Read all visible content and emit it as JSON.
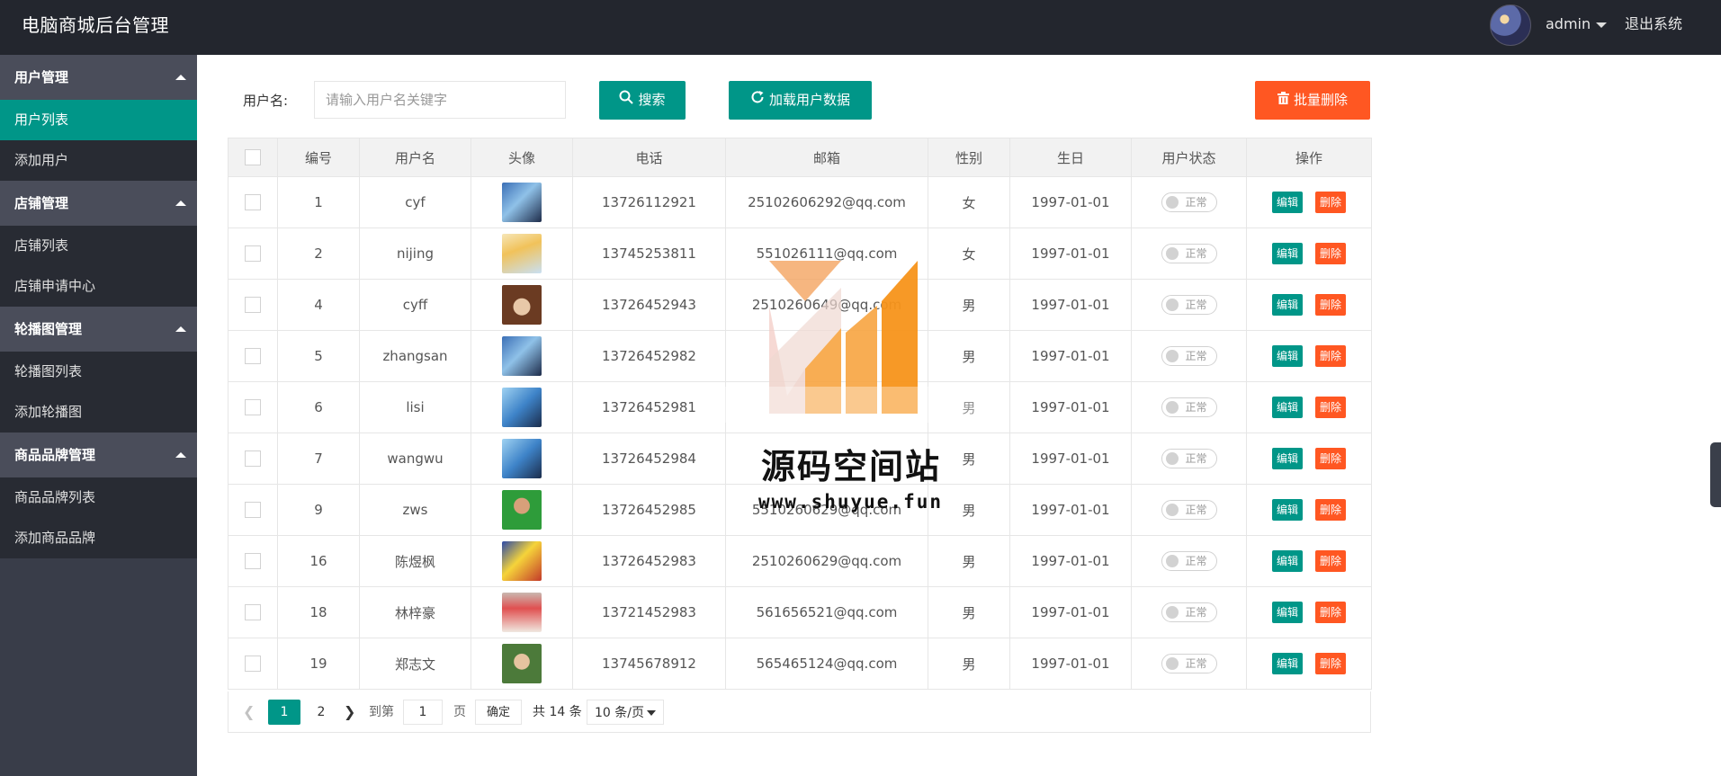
{
  "header": {
    "title": "电脑商城后台管理",
    "username": "admin",
    "logout_label": "退出系统"
  },
  "sidebar": {
    "groups": [
      {
        "title": "用户管理",
        "items": [
          {
            "label": "用户列表",
            "active": true
          },
          {
            "label": "添加用户"
          }
        ]
      },
      {
        "title": "店铺管理",
        "items": [
          {
            "label": "店铺列表"
          },
          {
            "label": "店铺申请中心"
          }
        ]
      },
      {
        "title": "轮播图管理",
        "items": [
          {
            "label": "轮播图列表"
          },
          {
            "label": "添加轮播图"
          }
        ]
      },
      {
        "title": "商品品牌管理",
        "items": [
          {
            "label": "商品品牌列表"
          },
          {
            "label": "添加商品品牌"
          }
        ]
      }
    ]
  },
  "toolbar": {
    "username_label": "用户名:",
    "search_placeholder": "请输入用户名关键字",
    "search_value": "",
    "search_button": "搜索",
    "load_button": "加载用户数据",
    "batch_delete_button": "批量删除"
  },
  "table": {
    "columns": [
      "编号",
      "用户名",
      "头像",
      "电话",
      "邮箱",
      "性别",
      "生日",
      "用户状态",
      "操作"
    ],
    "rows": [
      {
        "id": "1",
        "username": "cyf",
        "avatar": "avatar-photo",
        "phone": "13726112921",
        "email": "2510260629​2@qq.com",
        "gender": "女",
        "birthday": "1997-01-01",
        "status": "正常"
      },
      {
        "id": "2",
        "username": "nijing",
        "avatar": "avatar-photo",
        "phone": "13745253811",
        "email": "551026111@qq.com",
        "gender": "女",
        "birthday": "1997-01-01",
        "status": "正常"
      },
      {
        "id": "4",
        "username": "cyff",
        "avatar": "avatar-photo",
        "phone": "13726452943",
        "email": "2510260649@qq.com",
        "gender": "男",
        "birthday": "1997-01-01",
        "status": "正常"
      },
      {
        "id": "5",
        "username": "zhangsan",
        "avatar": "avatar-photo",
        "phone": "13726452982",
        "email": "",
        "gender": "男",
        "birthday": "1997-01-01",
        "status": "正常"
      },
      {
        "id": "6",
        "username": "lisi",
        "avatar": "avatar-photo",
        "phone": "13726452981",
        "email": "",
        "gender": "男",
        "birthday": "1997-01-01",
        "status": "正常"
      },
      {
        "id": "7",
        "username": "wangwu",
        "avatar": "avatar-photo",
        "phone": "13726452984",
        "email": "",
        "gender": "男",
        "birthday": "1997-01-01",
        "status": "正常"
      },
      {
        "id": "9",
        "username": "zws",
        "avatar": "avatar-photo",
        "phone": "13726452985",
        "email": "5510260629@qq.com",
        "gender": "男",
        "birthday": "1997-01-01",
        "status": "正常"
      },
      {
        "id": "16",
        "username": "陈煜枫",
        "avatar": "avatar-photo",
        "phone": "13726452983",
        "email": "2510260629@qq.com",
        "gender": "男",
        "birthday": "1997-01-01",
        "status": "正常"
      },
      {
        "id": "18",
        "username": "林梓豪",
        "avatar": "avatar-photo",
        "phone": "13721452983",
        "email": "561656521@qq.com",
        "gender": "男",
        "birthday": "1997-01-01",
        "status": "正常"
      },
      {
        "id": "19",
        "username": "郑志文",
        "avatar": "avatar-photo",
        "phone": "13745678912",
        "email": "565465124@qq.com",
        "gender": "男",
        "birthday": "1997-01-01",
        "status": "正常"
      }
    ],
    "edit_label": "编辑",
    "delete_label": "删除"
  },
  "pager": {
    "current_page": "1",
    "next_page": "2",
    "goto_label": "到第",
    "page_input_value": "1",
    "page_label": "页",
    "confirm_label": "确定",
    "total_label": "共 14 条",
    "page_size_label": "10 条/页"
  },
  "watermark": {
    "title": "源码空间站",
    "url": "www.shuyue.fun"
  },
  "colors": {
    "header_bg": "#23262e",
    "sidebar_bg": "#393d49",
    "accent_green": "#009688",
    "accent_orange": "#ff5722"
  },
  "icons": {
    "search": "search-icon",
    "refresh": "refresh-icon",
    "trash": "trash-icon"
  }
}
